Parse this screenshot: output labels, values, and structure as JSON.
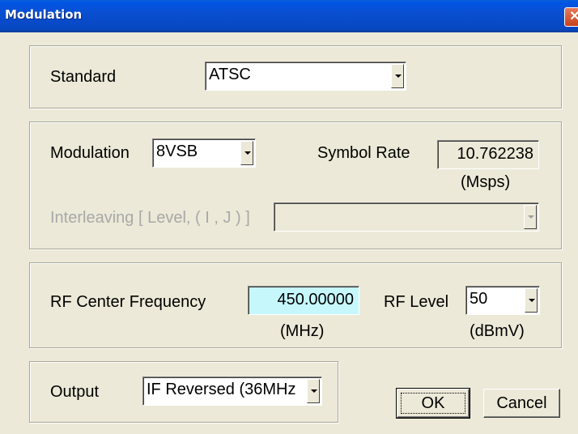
{
  "window": {
    "title": "Modulation"
  },
  "standard": {
    "label": "Standard",
    "value": "ATSC"
  },
  "modulation": {
    "label": "Modulation",
    "value": "8VSB",
    "symbol_rate_label": "Symbol Rate",
    "symbol_rate_value": "10.762238",
    "symbol_rate_unit": "(Msps)",
    "interleaving_label": "Interleaving [ Level, ( I , J ) ]",
    "interleaving_value": ""
  },
  "rf": {
    "center_label": "RF Center Frequency",
    "center_value": "450.00000",
    "center_unit": "(MHz)",
    "level_label": "RF Level",
    "level_value": "50",
    "level_unit": "(dBmV)"
  },
  "output": {
    "label": "Output",
    "value": "IF Reversed (36MHz"
  },
  "buttons": {
    "ok": "OK",
    "cancel": "Cancel"
  },
  "colors": {
    "frequency_field_bg": "#c6f7fb",
    "title_bar": "#0a4fd0"
  }
}
